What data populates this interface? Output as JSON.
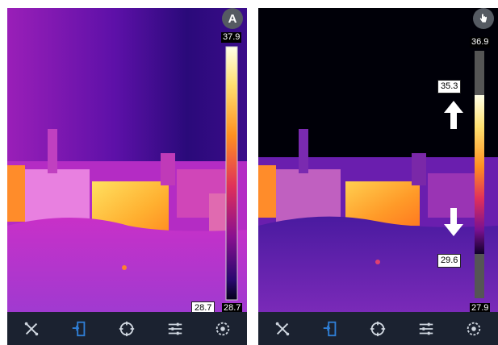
{
  "left_screen": {
    "mode_icon_text": "A",
    "scale_max": "37.9",
    "scale_min": "28.7",
    "level_low": "28.7"
  },
  "right_screen": {
    "scale_max": "36.9",
    "scale_min": "27.9",
    "level_high": "35.3",
    "level_low": "29.6",
    "level_high_fraction": 0.16,
    "level_low_fraction": 0.81
  },
  "toolbar_icons": [
    "measure-tools-icon",
    "save-image-icon",
    "center-spot-icon",
    "adjust-sliders-icon",
    "settings-gear-icon"
  ],
  "colors": {
    "toolbar_bg": "#1b2230",
    "toolbar_icon": "#cfd6df",
    "toolbar_active": "#2f7fd6"
  }
}
